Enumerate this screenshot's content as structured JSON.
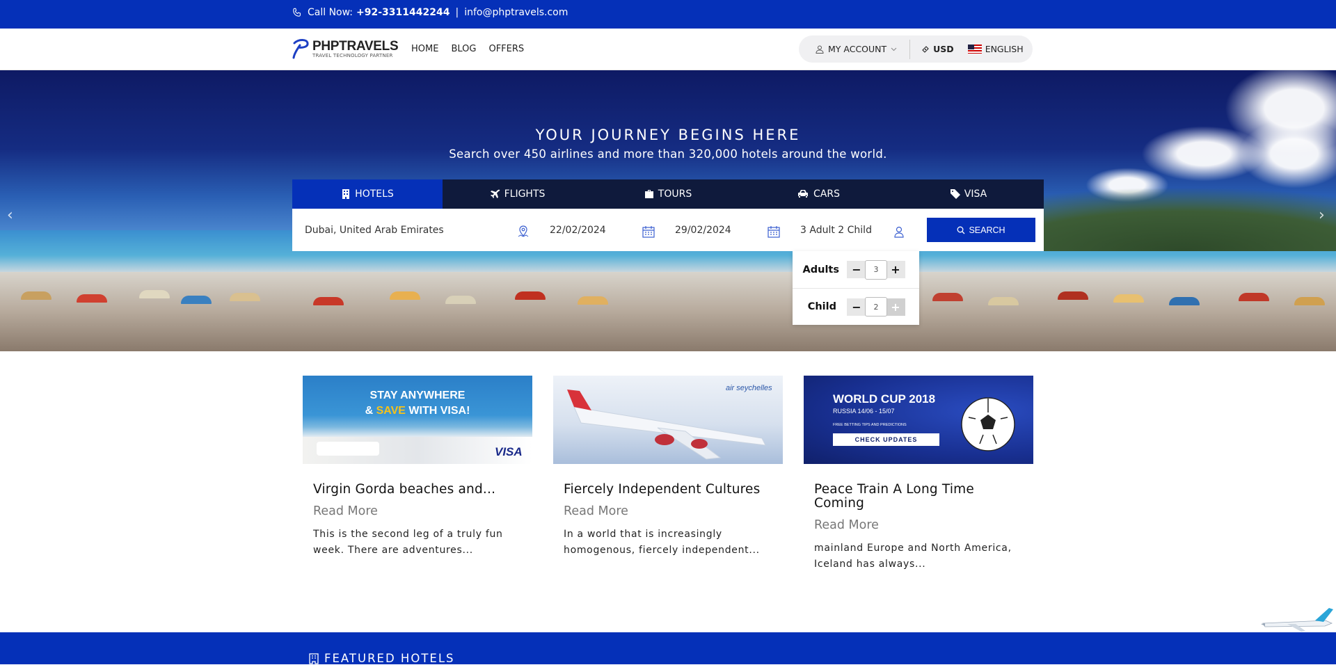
{
  "topbar": {
    "call_label": "Call Now:",
    "phone": "+92-3311442244",
    "separator": "|",
    "email": "info@phptravels.com"
  },
  "navbar": {
    "logo_brand": "PHPTRAVELS",
    "logo_tagline": "TRAVEL TECHNOLOGY PARTNER",
    "links": [
      "HOME",
      "BLOG",
      "OFFERS"
    ],
    "account_label": "MY ACCOUNT",
    "currency": "USD",
    "language": "ENGLISH"
  },
  "hero": {
    "title": "YOUR JOURNEY BEGINS HERE",
    "subtitle": "Search over 450 airlines and more than 320,000 hotels around the world.",
    "prev_arrow": "‹",
    "next_arrow": "›"
  },
  "tabs": [
    {
      "label": "HOTELS",
      "icon": "building-icon",
      "active": true
    },
    {
      "label": "FLIGHTS",
      "icon": "plane-icon",
      "active": false
    },
    {
      "label": "TOURS",
      "icon": "suitcase-icon",
      "active": false
    },
    {
      "label": "CARS",
      "icon": "car-icon",
      "active": false
    },
    {
      "label": "VISA",
      "icon": "tag-icon",
      "active": false
    }
  ],
  "search": {
    "destination": "Dubai, United Arab Emirates",
    "checkin": "22/02/2024",
    "checkout": "29/02/2024",
    "guests": "3 Adult 2 Child",
    "button_label": "SEARCH"
  },
  "guests_dropdown": {
    "adults_label": "Adults",
    "adults_value": "3",
    "child_label": "Child",
    "child_value": "2",
    "minus": "−",
    "plus": "+"
  },
  "cards": [
    {
      "banner_line1": "STAY ANYWHERE",
      "banner_line2a": "& ",
      "banner_line2b": "SAVE",
      "banner_line2c": " WITH VISA!",
      "banner_brand": "VISA",
      "title": "Virgin Gorda beaches and...",
      "more": "Read More",
      "excerpt": "This is the second leg of a truly fun week. There are adventures..."
    },
    {
      "banner_brand": "air seychelles",
      "title": "Fiercely Independent Cultures",
      "more": "Read More",
      "excerpt": "In a world that is increasingly homogenous, fiercely independent..."
    },
    {
      "banner_line1": "WORLD CUP 2018",
      "banner_line2": "RUSSIA 14/06 - 15/07",
      "banner_line3": "FREE BETTING TIPS AND PREDICTIONS",
      "banner_button": "CHECK UPDATES",
      "title": "Peace Train A Long Time Coming",
      "more": "Read More",
      "excerpt": " mainland Europe and North America, Iceland has always..."
    }
  ],
  "featured": {
    "title": "FEATURED HOTELS"
  },
  "colors": {
    "primary": "#0530b8",
    "tabs_bg": "#0f1a3c"
  }
}
